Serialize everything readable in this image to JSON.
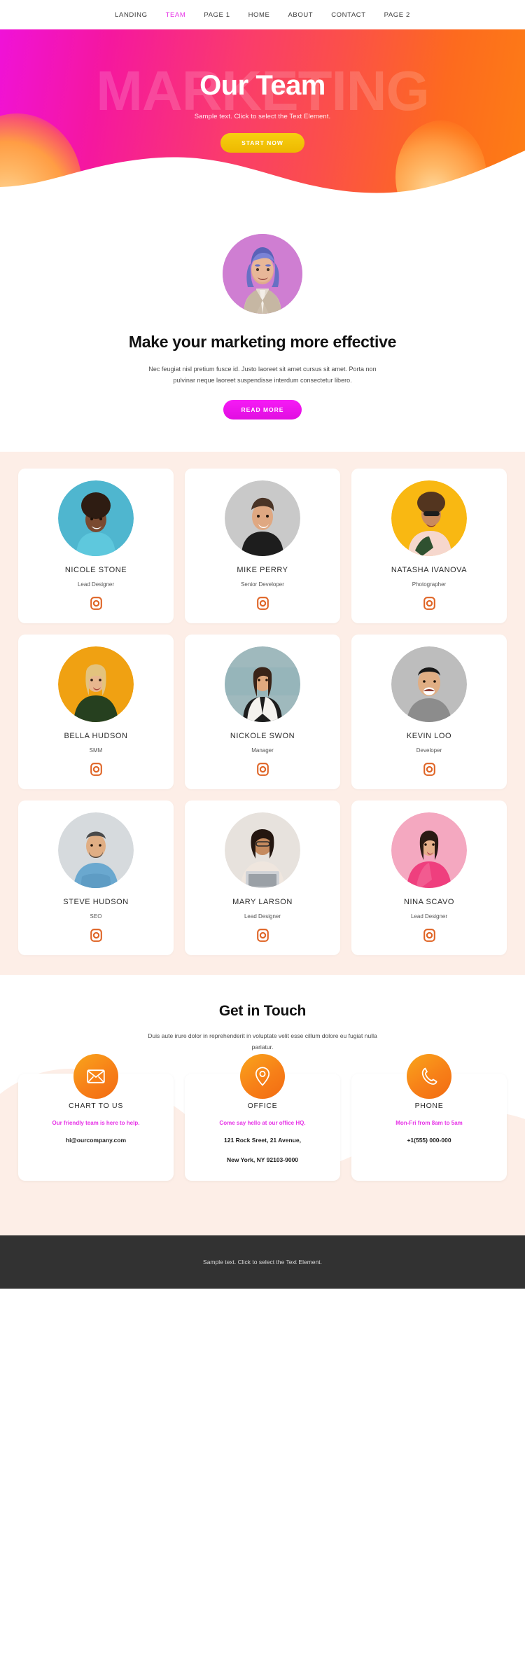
{
  "nav": {
    "items": [
      {
        "label": "LANDING",
        "active": false
      },
      {
        "label": "TEAM",
        "active": true
      },
      {
        "label": "PAGE 1",
        "active": false
      },
      {
        "label": "HOME",
        "active": false
      },
      {
        "label": "ABOUT",
        "active": false
      },
      {
        "label": "CONTACT",
        "active": false
      },
      {
        "label": "PAGE 2",
        "active": false
      }
    ]
  },
  "hero": {
    "watermark": "MARKETING",
    "title": "Our Team",
    "subtitle": "Sample text. Click to select the Text Element.",
    "cta": "START NOW",
    "gradient_from": "#f012d8",
    "gradient_to": "#fd7e14",
    "cta_color": "#f0c40a"
  },
  "intro": {
    "avatar_name": "avatar-3d-character",
    "avatar_bg": "#cf7ed2",
    "heading": "Make your marketing more effective",
    "paragraph": "Nec feugiat nisl pretium fusce id. Justo laoreet sit amet cursus sit amet. Porta non pulvinar neque laoreet suspendisse interdum consectetur libero.",
    "cta": "READ MORE",
    "cta_color": "#ee11ee"
  },
  "team": {
    "section_bg": "#fdeee7",
    "icon_name": "instagram-icon",
    "icon_color": "#df6425",
    "rows": [
      [
        {
          "name": "NICOLE STONE",
          "role": "Lead Designer",
          "photo_bg": "#4fb6cf"
        },
        {
          "name": "MIKE PERRY",
          "role": "Senior Developer",
          "photo_bg": "#c9c9c9"
        },
        {
          "name": "NATASHA IVANOVA",
          "role": "Photographer",
          "photo_bg": "#f9b812"
        }
      ],
      [
        {
          "name": "BELLA HUDSON",
          "role": "SMM",
          "photo_bg": "#f0a112"
        },
        {
          "name": "NICKOLE SWON",
          "role": "Manager",
          "photo_bg": "#9fb9bd"
        },
        {
          "name": "KEVIN LOO",
          "role": "Developer",
          "photo_bg": "#bdbdbd"
        }
      ],
      [
        {
          "name": "STEVE HUDSON",
          "role": "SEO",
          "photo_bg": "#d6dadd"
        },
        {
          "name": "MARY LARSON",
          "role": "Lead Designer",
          "photo_bg": "#e7e2dd"
        },
        {
          "name": "NINA SCAVO",
          "role": "Lead Designer",
          "photo_bg": "#f4a8c0"
        }
      ]
    ]
  },
  "contact": {
    "heading": "Get in Touch",
    "paragraph": "Duis aute irure dolor in reprehenderit in voluptate velit esse cillum dolore eu fugiat nulla pariatur.",
    "accent": "#e733e7",
    "circle_color": "#f7891a",
    "cards": [
      {
        "icon": "envelope-icon",
        "label": "CHART TO US",
        "note": "Our friendly team is here to help.",
        "value_line1": "hi@ourcompany.com",
        "value_line2": ""
      },
      {
        "icon": "map-pin-icon",
        "label": "OFFICE",
        "note": "Come say hello at our office HQ.",
        "value_line1": "121 Rock Sreet, 21 Avenue,",
        "value_line2": "New York, NY 92103-9000"
      },
      {
        "icon": "phone-icon",
        "label": "PHONE",
        "note": "Mon-Fri from 8am to 5am",
        "value_line1": "+1(555) 000-000",
        "value_line2": ""
      }
    ]
  },
  "footer": {
    "text": "Sample text. Click to select the Text Element.",
    "bg": "#323232"
  }
}
